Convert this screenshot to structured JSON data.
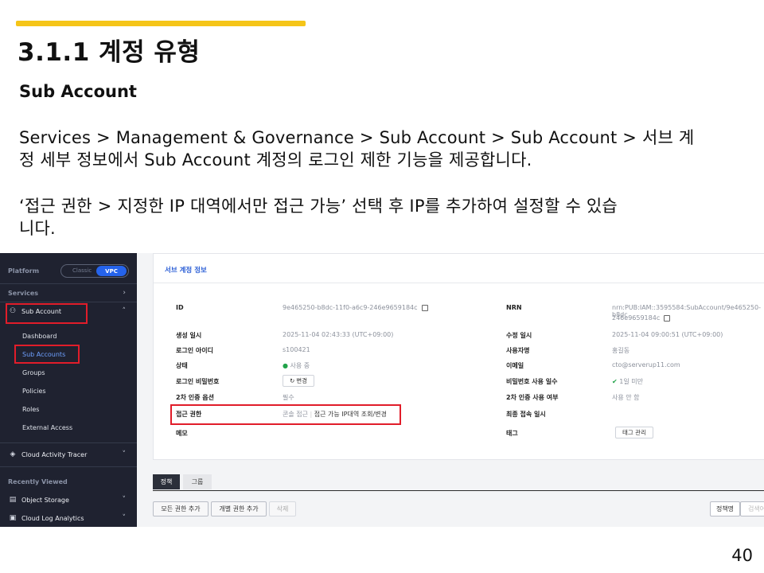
{
  "slide": {
    "title": "3.1.1 계정 유형",
    "subtitle": "Sub Account",
    "para1_line1": "Services > Management & Governance > Sub Account > Sub Account > 서브 계",
    "para1_line2": "정 세부 정보에서 Sub Account 계정의 로그인 제한 기능을 제공합니다.",
    "para2_line1": "‘접근 권한 > 지정한 IP 대역에서만 접근 가능’ 선택 후 IP를 추가하여 설정할 수 있습",
    "para2_line2": "니다.",
    "page_number": "40",
    "accent_color": "#f5c518"
  },
  "sidebar": {
    "platform_label": "Platform",
    "toggle_classic": "Classic",
    "toggle_vpc": "VPC",
    "services_label": "Services",
    "sub_account": "Sub Account",
    "sub_items": [
      "Dashboard",
      "Sub Accounts",
      "Groups",
      "Policies",
      "Roles",
      "External Access"
    ],
    "cloud_activity_tracer": "Cloud Activity Tracer",
    "recently_viewed_label": "Recently Viewed",
    "recent_items": [
      "Object Storage",
      "Cloud Log Analytics"
    ],
    "highlight_color": "#e11d2a"
  },
  "detail": {
    "card_title": "서브 계정 정보",
    "left": {
      "id_label": "ID",
      "id_value": "9e465250-b8dc-11f0-a6c9-246e9659184c",
      "created_label": "생성 일시",
      "created_value": "2025-11-04 02:43:33 (UTC+09:00)",
      "login_id_label": "로그인 아이디",
      "login_id_value": "s100421",
      "status_label": "상태",
      "status_value": "사용 중",
      "password_label": "로그인 비밀번호",
      "password_button": "변경",
      "mfa_label": "2차 인증 옵션",
      "mfa_value": "필수",
      "access_label": "접근 권한",
      "access_value": "콘솔 접근",
      "access_detail": "접근 가능 IP대역 조회/변경",
      "memo_label": "메모"
    },
    "right": {
      "nrn_label": "NRN",
      "nrn_value_1": "nrn:PUB:IAM::3595584:SubAccount/9e465250-b8dc",
      "nrn_value_2": "246e9659184c",
      "modified_label": "수정 일시",
      "modified_value": "2025-11-04 09:00:51 (UTC+09:00)",
      "username_label": "사용자명",
      "username_value": "홍길동",
      "email_label": "이메일",
      "email_value": "cto@serverup11.com",
      "pw_days_label": "비밀번호 사용 일수",
      "pw_days_value": "1일 미만",
      "mfa_use_label": "2차 인증 사용 여부",
      "mfa_use_value": "사용 안 함",
      "last_login_label": "최종 접속 일시",
      "tag_label": "태그",
      "tag_button": "태그 관리"
    }
  },
  "tabs": [
    "정책",
    "그룹"
  ],
  "actions": {
    "add_all": "모든 권한 추가",
    "add_individual": "개별 권한 추가",
    "delete": "삭제",
    "policy_name_filter": "정책명",
    "search_placeholder": "검색어"
  }
}
